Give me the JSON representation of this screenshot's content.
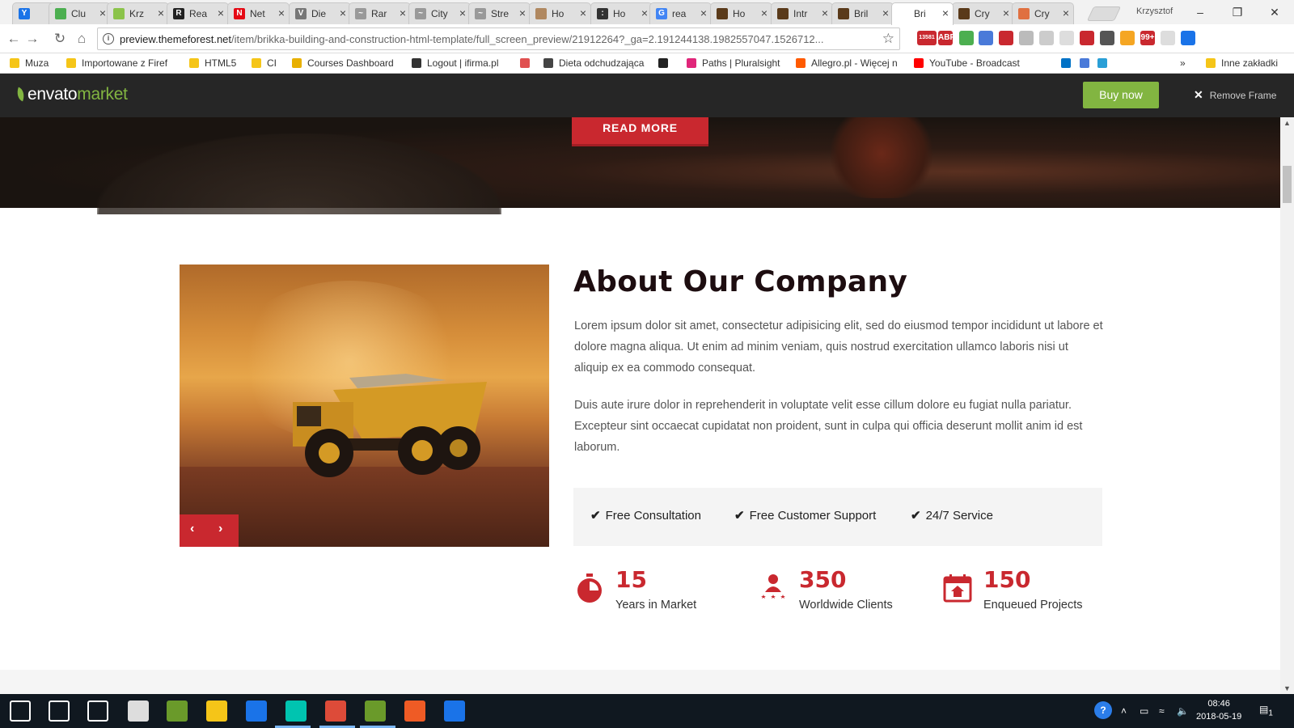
{
  "browser": {
    "tabs": [
      {
        "title": "",
        "color": "#1a73e8",
        "glyph": "Y"
      },
      {
        "title": "Clu",
        "color": "#4caf50",
        "glyph": ""
      },
      {
        "title": "Krz",
        "color": "#8bc34a",
        "glyph": ""
      },
      {
        "title": "Rea",
        "color": "#222222",
        "glyph": "R"
      },
      {
        "title": "Net",
        "color": "#e50914",
        "glyph": "N"
      },
      {
        "title": "Die",
        "color": "#777777",
        "glyph": "V"
      },
      {
        "title": "Rar",
        "color": "#999999",
        "glyph": "~"
      },
      {
        "title": "City",
        "color": "#999999",
        "glyph": "~"
      },
      {
        "title": "Stre",
        "color": "#999999",
        "glyph": "~"
      },
      {
        "title": "Ho",
        "color": "#b08860",
        "glyph": ""
      },
      {
        "title": "Ho",
        "color": "#333333",
        "glyph": ":"
      },
      {
        "title": "rea",
        "color": "#4285f4",
        "glyph": "G"
      },
      {
        "title": "Ho",
        "color": "#5a3a1a",
        "glyph": ""
      },
      {
        "title": "Intr",
        "color": "#5a3a1a",
        "glyph": ""
      },
      {
        "title": "Bril",
        "color": "#5a3a1a",
        "glyph": ""
      },
      {
        "title": "Bri",
        "color": "#ffffff",
        "glyph": ""
      },
      {
        "title": "Cry",
        "color": "#5a3a1a",
        "glyph": ""
      },
      {
        "title": "Cry",
        "color": "#e07040",
        "glyph": ""
      }
    ],
    "active_tab_index": 15,
    "profile_name": "Krzysztof",
    "url_host": "preview.themeforest.net",
    "url_path": "/item/brikka-building-and-construction-html-template/full_screen_preview/21912264?_ga=2.191244138.1982557047.1526712...",
    "extensions": [
      {
        "label": "13581",
        "color": "#c9282f"
      },
      {
        "label": "ABP",
        "color": "#c9282f"
      },
      {
        "label": "",
        "color": "#4caf50"
      },
      {
        "label": "",
        "color": "#4a7ad9"
      },
      {
        "label": "",
        "color": "#c9282f"
      },
      {
        "label": "",
        "color": "#bbbbbb"
      },
      {
        "label": "",
        "color": "#cccccc"
      },
      {
        "label": "",
        "color": "#dddddd"
      },
      {
        "label": "",
        "color": "#c9282f"
      },
      {
        "label": "",
        "color": "#555555"
      },
      {
        "label": "",
        "color": "#f5a623"
      },
      {
        "label": "99+",
        "color": "#c9282f"
      },
      {
        "label": "",
        "color": "#dddddd"
      },
      {
        "label": "",
        "color": "#1a73e8"
      }
    ],
    "bookmarks": [
      {
        "label": "Muza",
        "icon": "folder",
        "color": "#f5c518"
      },
      {
        "label": "Importowane z Firef",
        "icon": "folder",
        "color": "#f5c518"
      },
      {
        "label": "HTML5",
        "icon": "folder",
        "color": "#f5c518"
      },
      {
        "label": "CI",
        "icon": "folder",
        "color": "#f5c518"
      },
      {
        "label": "Courses Dashboard",
        "icon": "crown",
        "color": "#e8b000"
      },
      {
        "label": "Logout | ifirma.pl",
        "icon": "ifi",
        "color": "#333333"
      },
      {
        "label": "",
        "icon": "script",
        "color": "#e05050"
      },
      {
        "label": "Dieta odchudzająca",
        "icon": "v",
        "color": "#444444"
      },
      {
        "label": "",
        "icon": "int",
        "color": "#222222"
      },
      {
        "label": "Paths | Pluralsight",
        "icon": "ps",
        "color": "#e0267a"
      },
      {
        "label": "Allegro.pl - Więcej n",
        "icon": "allegro",
        "color": "#ff5a00"
      },
      {
        "label": "YouTube - Broadcast",
        "icon": "youtube",
        "color": "#ff0000"
      },
      {
        "label": "",
        "icon": "outlook",
        "color": "#0072c6"
      },
      {
        "label": "",
        "icon": "translate",
        "color": "#4a7ad9"
      },
      {
        "label": "",
        "icon": "app",
        "color": "#2a9fd6"
      }
    ],
    "other_bookmarks": "Inne zakładki",
    "overflow": "»"
  },
  "envato": {
    "logo_main": "envato",
    "logo_market": "market",
    "buy_label": "Buy now",
    "remove_frame_label": "Remove Frame"
  },
  "page": {
    "read_more": "READ MORE",
    "about_title": "About Our Company",
    "paragraph1": "Lorem ipsum dolor sit amet, consectetur adipisicing elit, sed do eiusmod tempor incididunt ut labore et dolore magna aliqua. Ut enim ad minim veniam, quis nostrud exercitation ullamco laboris nisi ut aliquip ex ea commodo consequat.",
    "paragraph2": "Duis aute irure dolor in reprehenderit in voluptate velit esse cillum dolore eu fugiat nulla pariatur. Excepteur sint occaecat cupidatat non proident, sunt in culpa qui officia deserunt mollit anim id est laborum.",
    "features": [
      "Free Consultation",
      "Free Customer Support",
      "24/7 Service"
    ],
    "stats": [
      {
        "value": "15",
        "label": "Years in Market",
        "icon": "stopwatch-icon"
      },
      {
        "value": "350",
        "label": "Worldwide Clients",
        "icon": "clients-icon"
      },
      {
        "value": "150",
        "label": "Enqueued Projects",
        "icon": "calendar-icon"
      }
    ],
    "accent_color": "#c9282f"
  },
  "taskbar": {
    "apps": [
      "start",
      "search",
      "task-view",
      "calculator",
      "lambda",
      "explorer",
      "maps",
      "webstorm",
      "chrome",
      "lambda2",
      "postman",
      "maps2"
    ],
    "time": "08:46",
    "date": "2018-05-19",
    "notification_count": "1"
  }
}
